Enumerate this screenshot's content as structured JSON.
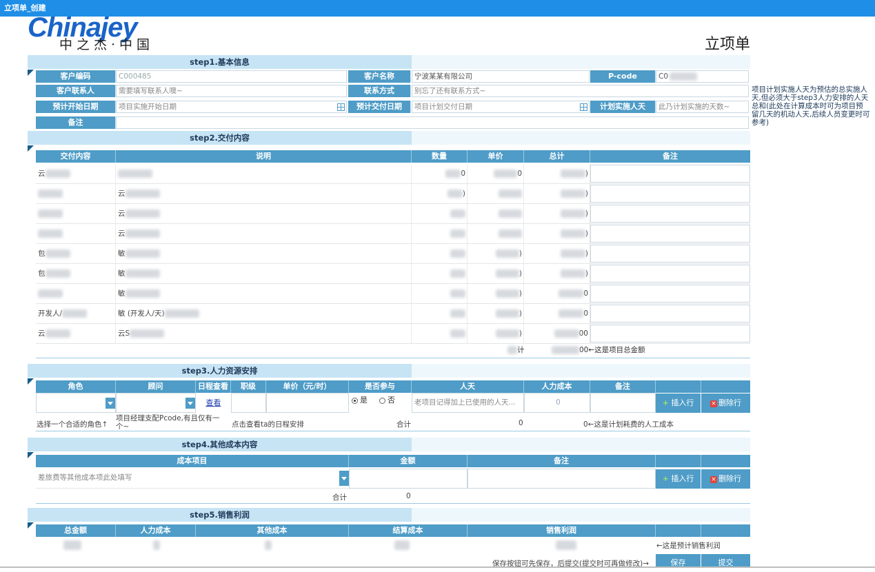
{
  "window_title": "立项单_创建",
  "logo": {
    "en": "Chinajey",
    "cn": "中之杰·中国"
  },
  "page_title": "立项单",
  "side_note": "项目计划实施人天为预估的总实施人天,但必须大于step3人力安排的人天总和(此处在计算成本时可为项目预留几天的机动人天,后续人员变更时可参考)",
  "step1": {
    "title": "step1.基本信息",
    "customer_code_label": "客户编码",
    "customer_code": "C000485",
    "customer_name_label": "客户名称",
    "customer_name": "宁波某某有限公司",
    "pcode_label": "P-code",
    "pcode": "C0",
    "contact_label": "客户联系人",
    "contact_placeholder": "需要填写联系人噢~",
    "contact_way_label": "联系方式",
    "contact_way_placeholder": "别忘了还有联系方式~",
    "start_label": "预计开始日期",
    "start_placeholder": "项目实施开始日期",
    "delivery_label": "预计交付日期",
    "delivery_placeholder": "项目计划交付日期",
    "days_label": "计划实施人天",
    "days_placeholder": "此乃计划实施的天数~",
    "remark_label": "备注"
  },
  "step2": {
    "title": "step2.交付内容",
    "headers": [
      "交付内容",
      "说明",
      "数量",
      "单价",
      "总计",
      "备注"
    ],
    "rows": [
      {
        "content": "云",
        "desc": "",
        "qty": "0",
        "price": "0",
        "total": ")"
      },
      {
        "content": "",
        "desc": "云",
        "qty": ")",
        "price": "",
        "total": ")"
      },
      {
        "content": "",
        "desc": "云",
        "qty": "",
        "price": "",
        "total": ")"
      },
      {
        "content": "",
        "desc": "云",
        "qty": "",
        "price": "",
        "total": ")"
      },
      {
        "content": "包",
        "desc": "敏",
        "qty": "",
        "price": ")",
        "total": ")"
      },
      {
        "content": "包",
        "desc": "敏",
        "qty": "",
        "price": ")",
        "total": ")"
      },
      {
        "content": "",
        "desc": "敏",
        "qty": "",
        "price": ")",
        "total": "0"
      },
      {
        "content": "开发人/",
        "desc": "敏  (开发人/天)",
        "qty": "",
        "price": ")",
        "total": "0"
      },
      {
        "content": "云",
        "desc": "云S",
        "qty": "",
        "price": ")",
        "total": "00"
      }
    ],
    "total_label": "计",
    "total_value": "00",
    "total_note": "←这是项目总金额"
  },
  "step3": {
    "title": "step3.人力资源安排",
    "headers": [
      "角色",
      "顾问",
      "日程查看",
      "职级",
      "单价（元/时）",
      "是否参与",
      "人天",
      "人力成本",
      "备注"
    ],
    "view_link": "查看",
    "yes": "是",
    "no": "否",
    "mandays_placeholder": "老项目记得加上已使用的人天...",
    "labor_cost": "0",
    "insert_btn": "插入行",
    "delete_btn": "删除行",
    "hint_role": "选择一个合适的角色↑",
    "hint_consultant": "项目经理支配Pcode,有且仅有一个~",
    "hint_schedule": "点击查看ta的日程安排",
    "sum_label": "合计",
    "sum_days": "0",
    "sum_cost": "0",
    "sum_note": "←这是计划耗费的人工成本"
  },
  "step4": {
    "title": "step4.其他成本内容",
    "headers": [
      "成本项目",
      "金额",
      "备注"
    ],
    "item_placeholder": "差旅费等其他成本项此处填写",
    "insert_btn": "插入行",
    "delete_btn": "删除行",
    "sum_label": "合计",
    "sum_value": "0"
  },
  "step5": {
    "title": "step5.销售利润",
    "headers": [
      "总金额",
      "人力成本",
      "其他成本",
      "结算成本",
      "销售利润"
    ],
    "profit_note": "←这是预计销售利润",
    "save_note": "保存按钮可先保存，后提交(提交时可再做修改)→",
    "save_btn": "保存",
    "submit_btn": "提交"
  }
}
